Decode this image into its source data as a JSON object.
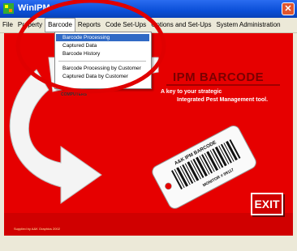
{
  "window": {
    "title": "WinIPM",
    "close_glyph": "✕"
  },
  "menubar": {
    "items": [
      {
        "label": "File",
        "name": "menu-file"
      },
      {
        "label": "Property",
        "name": "menu-property"
      },
      {
        "label": "Barcode",
        "name": "menu-barcode",
        "active": true
      },
      {
        "label": "Reports",
        "name": "menu-reports"
      },
      {
        "label": "Code Set-Ups",
        "name": "menu-code-set-ups"
      },
      {
        "label": "Options and Set-Ups",
        "name": "menu-options-and-set-ups"
      },
      {
        "label": "System Administration",
        "name": "menu-system-administration"
      }
    ]
  },
  "barcode_menu": {
    "items": [
      {
        "label": "Barcode Processing",
        "selected": true
      },
      {
        "label": "Captured Data"
      },
      {
        "label": "Barcode History"
      },
      {
        "label": "Barcode Processing by Customer"
      },
      {
        "label": "Captured Data by Customer"
      }
    ]
  },
  "brand": {
    "title": "IPM BARCODE",
    "tagline_line1": "A key to your strategic",
    "tagline_line2": "Integrated Pest Management tool.",
    "computers_label": "COMPUTERS",
    "card_title": "A&K IPM BARCODE",
    "card_monitor": "MONITOR # 99117",
    "footer": "Supplied by A&K Graphics 2002"
  },
  "actions": {
    "exit_label": "EXIT"
  },
  "colors": {
    "background_red": "#e60000",
    "highlight_blue": "#316ac5",
    "annotation_circle": "#e00000"
  }
}
